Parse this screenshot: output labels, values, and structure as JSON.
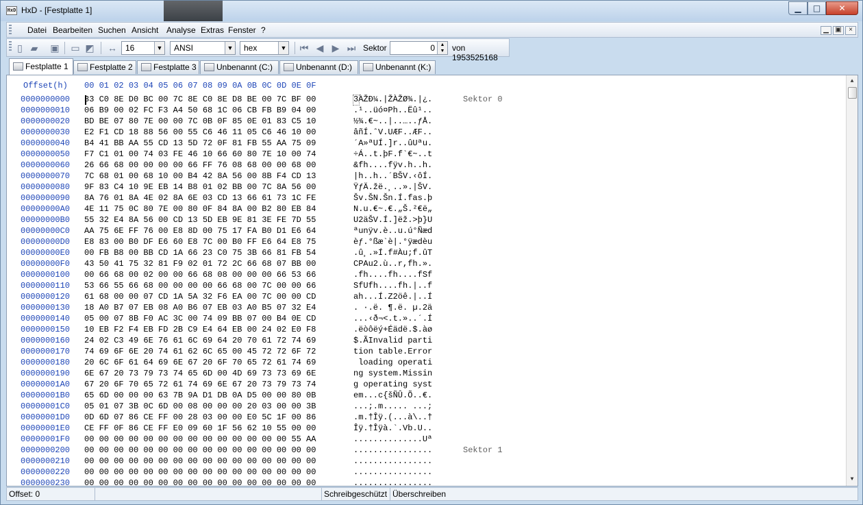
{
  "window": {
    "title": "HxD - [Festplatte 1]",
    "min_icon": "minimize-icon",
    "max_icon": "maximize-icon",
    "close_icon": "close-icon",
    "close_color": "#c7412b"
  },
  "menu": {
    "items": [
      "Datei",
      "Bearbeiten",
      "Suchen",
      "Ansicht",
      "Analyse",
      "Extras",
      "Fenster",
      "?"
    ],
    "mdi_buttons": [
      "minimize-icon",
      "restore-icon",
      "close-icon"
    ]
  },
  "toolbar": {
    "bytes_per_row": "16",
    "charset": "ANSI",
    "display_mode": "hex",
    "sector_label": "Sektor",
    "sector_value": "0",
    "total_label": "von 1953525168",
    "icons": [
      "new-file-icon",
      "open-file-icon",
      "save-icon",
      "drive-icon",
      "disk-image-icon",
      "bytes-per-row-icon",
      "first-sector-icon",
      "previous-sector-icon",
      "next-sector-icon",
      "last-sector-icon"
    ]
  },
  "tabs": [
    {
      "label": "Festplatte 1",
      "active": true
    },
    {
      "label": "Festplatte 2",
      "active": false
    },
    {
      "label": "Festplatte 3",
      "active": false
    },
    {
      "label": "Unbenannt (C:)",
      "active": false
    },
    {
      "label": "Unbenannt (D:)",
      "active": false
    },
    {
      "label": "Unbenannt (K:)",
      "active": false
    }
  ],
  "editor": {
    "offset_header": "Offset(h)",
    "column_headers": [
      "00",
      "01",
      "02",
      "03",
      "04",
      "05",
      "06",
      "07",
      "08",
      "09",
      "0A",
      "0B",
      "0C",
      "0D",
      "0E",
      "0F"
    ],
    "sector_labels": [
      "Sektor 0",
      "Sektor 1"
    ],
    "accent_color": "#1d45b7",
    "rows": [
      {
        "offset": "0000000000",
        "hex": "33 C0 8E D0 BC 00 7C 8E C0 8E D8 BE 00 7C BF 00",
        "ascii": "3ÀŽĐ¼.|ŽÀŽØ¾.|¿."
      },
      {
        "offset": "0000000010",
        "hex": "06 B9 00 02 FC F3 A4 50 68 1C 06 CB FB B9 04 00",
        "ascii": ".¹..üó¤Ph..Ëû¹.."
      },
      {
        "offset": "0000000020",
        "hex": "BD BE 07 80 7E 00 00 7C 0B 0F 85 0E 01 83 C5 10",
        "ascii": "½¾.€~..|..…..ƒÅ."
      },
      {
        "offset": "0000000030",
        "hex": "E2 F1 CD 18 88 56 00 55 C6 46 11 05 C6 46 10 00",
        "ascii": "âñÍ.ˆV.UÆF..ÆF.."
      },
      {
        "offset": "0000000040",
        "hex": "B4 41 BB AA 55 CD 13 5D 72 0F 81 FB 55 AA 75 09",
        "ascii": "´A»ªUÍ.]r..ûUªu."
      },
      {
        "offset": "0000000050",
        "hex": "F7 C1 01 00 74 03 FE 46 10 66 60 80 7E 10 00 74",
        "ascii": "÷Á..t.þF.f`€~..t"
      },
      {
        "offset": "0000000060",
        "hex": "26 66 68 00 00 00 00 66 FF 76 08 68 00 00 68 00",
        "ascii": "&fh....fÿv.h..h."
      },
      {
        "offset": "0000000070",
        "hex": "7C 68 01 00 68 10 00 B4 42 8A 56 00 8B F4 CD 13",
        "ascii": "|h..h..´BŠV.‹ôÍ."
      },
      {
        "offset": "0000000080",
        "hex": "9F 83 C4 10 9E EB 14 B8 01 02 BB 00 7C 8A 56 00",
        "ascii": "ŸƒÄ.žë.¸..».|ŠV."
      },
      {
        "offset": "0000000090",
        "hex": "8A 76 01 8A 4E 02 8A 6E 03 CD 13 66 61 73 1C FE",
        "ascii": "Šv.ŠN.Šn.Í.fas.þ"
      },
      {
        "offset": "00000000A0",
        "hex": "4E 11 75 0C 80 7E 00 80 0F 84 8A 00 B2 80 EB 84",
        "ascii": "N.u.€~.€.„Š.²€ë„"
      },
      {
        "offset": "00000000B0",
        "hex": "55 32 E4 8A 56 00 CD 13 5D EB 9E 81 3E FE 7D 55",
        "ascii": "U2äŠV.Í.]ëž.>þ}U"
      },
      {
        "offset": "00000000C0",
        "hex": "AA 75 6E FF 76 00 E8 8D 00 75 17 FA B0 D1 E6 64",
        "ascii": "ªunÿv.è..u.ú°Ñæd"
      },
      {
        "offset": "00000000D0",
        "hex": "E8 83 00 B0 DF E6 60 E8 7C 00 B0 FF E6 64 E8 75",
        "ascii": "èƒ.°ßæ`è|.°ÿædèu"
      },
      {
        "offset": "00000000E0",
        "hex": "00 FB B8 00 BB CD 1A 66 23 C0 75 3B 66 81 FB 54",
        "ascii": ".û¸.»Í.f#Àu;f.ûT"
      },
      {
        "offset": "00000000F0",
        "hex": "43 50 41 75 32 81 F9 02 01 72 2C 66 68 07 BB 00",
        "ascii": "CPAu2.ù..r,fh.»."
      },
      {
        "offset": "0000000100",
        "hex": "00 66 68 00 02 00 00 66 68 08 00 00 00 66 53 66",
        "ascii": ".fh....fh....fSf"
      },
      {
        "offset": "0000000110",
        "hex": "53 66 55 66 68 00 00 00 00 66 68 00 7C 00 00 66",
        "ascii": "SfUfh....fh.|..f"
      },
      {
        "offset": "0000000120",
        "hex": "61 68 00 00 07 CD 1A 5A 32 F6 EA 00 7C 00 00 CD",
        "ascii": "ah...Í.Z2öê.|..Í"
      },
      {
        "offset": "0000000130",
        "hex": "18 A0 B7 07 EB 08 A0 B6 07 EB 03 A0 B5 07 32 E4",
        "ascii": ". ·.ë. ¶.ë. µ.2ä"
      },
      {
        "offset": "0000000140",
        "hex": "05 00 07 8B F0 AC 3C 00 74 09 BB 07 00 B4 0E CD",
        "ascii": "...‹ð¬<.t.»..´.Í"
      },
      {
        "offset": "0000000150",
        "hex": "10 EB F2 F4 EB FD 2B C9 E4 64 EB 00 24 02 E0 F8",
        "ascii": ".ëòôëý+Éädë.$.àø"
      },
      {
        "offset": "0000000160",
        "hex": "24 02 C3 49 6E 76 61 6C 69 64 20 70 61 72 74 69",
        "ascii": "$.ÃInvalid parti"
      },
      {
        "offset": "0000000170",
        "hex": "74 69 6F 6E 20 74 61 62 6C 65 00 45 72 72 6F 72",
        "ascii": "tion table.Error"
      },
      {
        "offset": "0000000180",
        "hex": "20 6C 6F 61 64 69 6E 67 20 6F 70 65 72 61 74 69",
        "ascii": " loading operati"
      },
      {
        "offset": "0000000190",
        "hex": "6E 67 20 73 79 73 74 65 6D 00 4D 69 73 73 69 6E",
        "ascii": "ng system.Missin"
      },
      {
        "offset": "00000001A0",
        "hex": "67 20 6F 70 65 72 61 74 69 6E 67 20 73 79 73 74",
        "ascii": "g operating syst"
      },
      {
        "offset": "00000001B0",
        "hex": "65 6D 00 00 00 63 7B 9A D1 DB 0A D5 00 00 80 0B",
        "ascii": "em...c{šÑÛ.Õ..€."
      },
      {
        "offset": "00000001C0",
        "hex": "05 01 07 3B 0C 6D 00 08 00 00 00 20 03 00 00 3B",
        "ascii": "...;.m..... ...;"
      },
      {
        "offset": "00000001D0",
        "hex": "0D 6D 07 86 CE FF 00 28 03 00 00 E0 5C 1F 00 86",
        "ascii": ".m.†Îÿ.(...à\\..†"
      },
      {
        "offset": "00000001E0",
        "hex": "CE FF 0F 86 CE FF E0 09 60 1F 56 62 10 55 00 00",
        "ascii": "Îÿ.†Îÿà.`.Vb.U.."
      },
      {
        "offset": "00000001F0",
        "hex": "00 00 00 00 00 00 00 00 00 00 00 00 00 00 55 AA",
        "ascii": "..............Uª"
      },
      {
        "offset": "0000000200",
        "hex": "00 00 00 00 00 00 00 00 00 00 00 00 00 00 00 00",
        "ascii": "................"
      },
      {
        "offset": "0000000210",
        "hex": "00 00 00 00 00 00 00 00 00 00 00 00 00 00 00 00",
        "ascii": "................"
      },
      {
        "offset": "0000000220",
        "hex": "00 00 00 00 00 00 00 00 00 00 00 00 00 00 00 00",
        "ascii": "................"
      },
      {
        "offset": "0000000230",
        "hex": "00 00 00 00 00 00 00 00 00 00 00 00 00 00 00 00",
        "ascii": "................"
      }
    ]
  },
  "status": {
    "offset": "Offset: 0",
    "readonly": "Schreibgeschützt",
    "mode": "Überschreiben"
  }
}
